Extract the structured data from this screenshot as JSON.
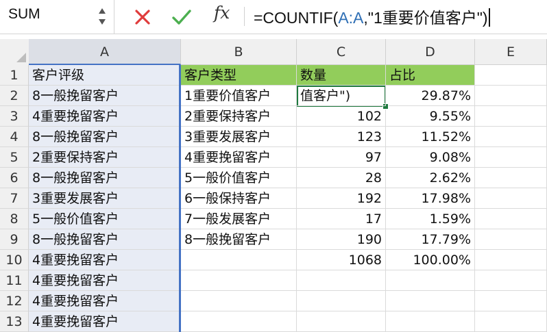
{
  "name_box": {
    "value": "SUM"
  },
  "formula_bar": {
    "prefix": "=COUNTIF(",
    "range_ref": "A:A",
    "suffix": ",\"1重要价值客户\")",
    "cancel_icon": "cancel-x-icon",
    "enter_icon": "enter-check-icon",
    "fx_label": "fx",
    "colors": {
      "cancel": "#e03c3c",
      "enter": "#4caf50",
      "ref": "#2f6fb5"
    }
  },
  "columns": [
    "A",
    "B",
    "C",
    "D",
    "E"
  ],
  "rows": [
    {
      "num": "1",
      "a": "客户评级",
      "b": "客户类型",
      "c": "数量",
      "d": "占比"
    },
    {
      "num": "2",
      "a": "8一般挽留客户",
      "b": "1重要价值客户",
      "c": "值客户\")",
      "d": "29.87%"
    },
    {
      "num": "3",
      "a": "4重要挽留客户",
      "b": "2重要保持客户",
      "c": "102",
      "d": "9.55%"
    },
    {
      "num": "4",
      "a": "8一般挽留客户",
      "b": "3重要发展客户",
      "c": "123",
      "d": "11.52%"
    },
    {
      "num": "5",
      "a": "2重要保持客户",
      "b": "4重要挽留客户",
      "c": "97",
      "d": "9.08%"
    },
    {
      "num": "6",
      "a": "8一般挽留客户",
      "b": "5一般价值客户",
      "c": "28",
      "d": "2.62%"
    },
    {
      "num": "7",
      "a": "3重要发展客户",
      "b": "6一般保持客户",
      "c": "192",
      "d": "17.98%"
    },
    {
      "num": "8",
      "a": "5一般价值客户",
      "b": "7一般发展客户",
      "c": "17",
      "d": "1.59%"
    },
    {
      "num": "9",
      "a": "8一般挽留客户",
      "b": "8一般挽留客户",
      "c": "190",
      "d": "17.79%"
    },
    {
      "num": "10",
      "a": "4重要挽留客户",
      "b": "",
      "c": "1068",
      "d": "100.00%"
    },
    {
      "num": "11",
      "a": "4重要挽留客户",
      "b": "",
      "c": "",
      "d": ""
    },
    {
      "num": "12",
      "a": "4重要挽留客户",
      "b": "",
      "c": "",
      "d": ""
    },
    {
      "num": "13",
      "a": "4重要挽留客户",
      "b": "",
      "c": "",
      "d": ""
    }
  ],
  "header_fill": "#92cd5b",
  "selected_column_fill": "#e8ecf5"
}
